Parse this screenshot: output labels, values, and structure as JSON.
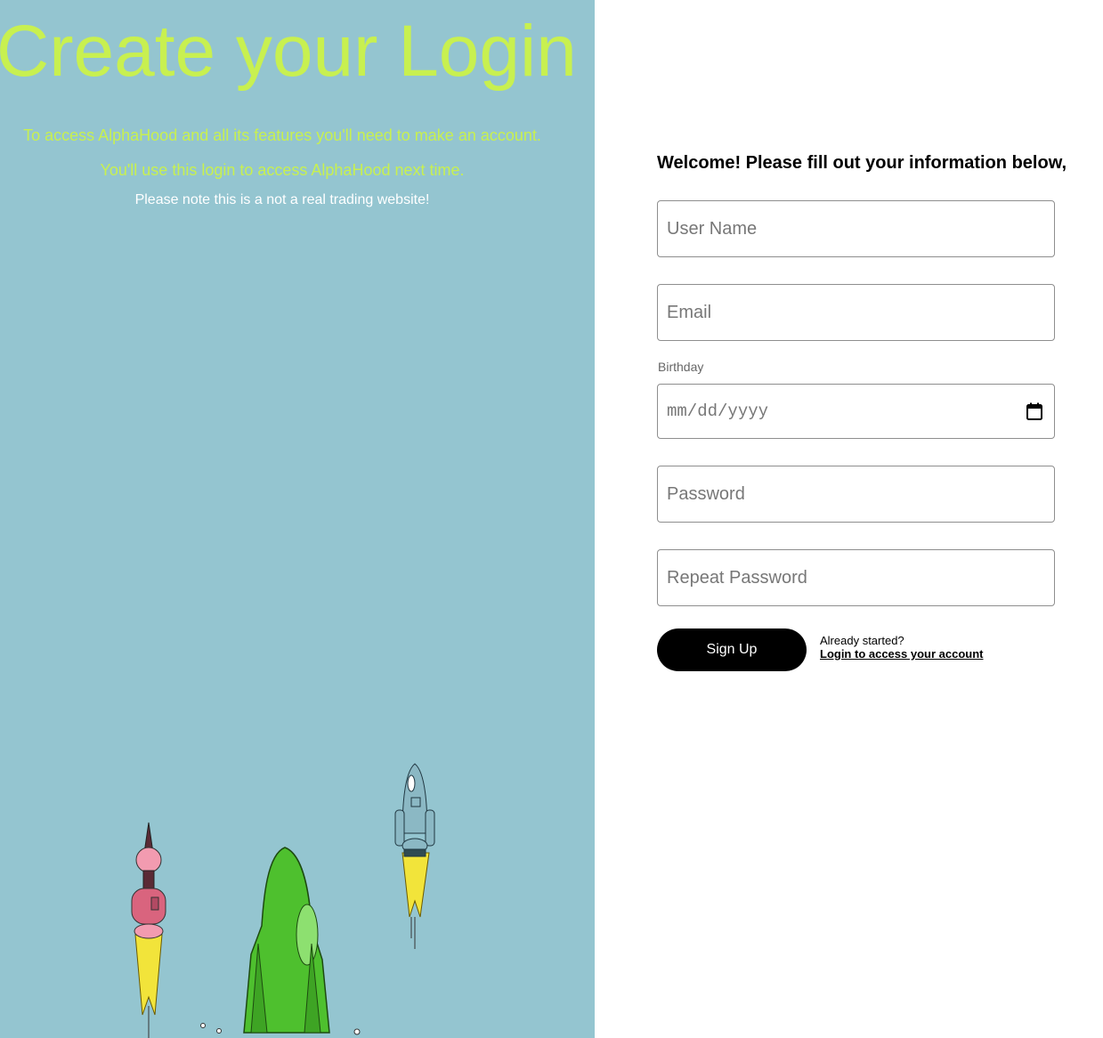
{
  "hero": {
    "title": "Create your Login",
    "line1": "To access AlphaHood and all its features you'll need to make an account.",
    "line2": "You'll use this login to access AlphaHood next time.",
    "note": "Please note this is a not a real trading website!"
  },
  "form": {
    "welcome": "Welcome! Please fill out your information below,",
    "username_placeholder": "User Name",
    "email_placeholder": "Email",
    "birthday_label": "Birthday",
    "birthday_placeholder": "mm/dd/yyyy",
    "password_placeholder": "Password",
    "repeat_password_placeholder": "Repeat Password",
    "signup_label": "Sign Up",
    "already_started": "Already started?",
    "login_link": "Login to access your account"
  },
  "colors": {
    "left_panel": "#94c5d0",
    "accent_text": "#c8f050",
    "button": "#000000"
  },
  "icons": [
    "calendar-icon",
    "pink-rocket-icon",
    "green-rocket-icon",
    "blue-rocket-icon"
  ]
}
